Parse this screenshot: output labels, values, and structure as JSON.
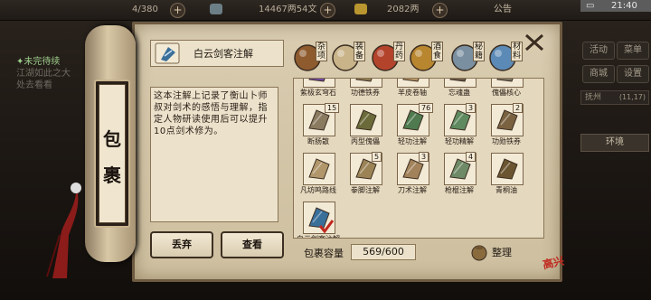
{
  "topbar": {
    "stamina": "4/380",
    "silver": "14467两54文",
    "gold": "2082两",
    "announce": "公告",
    "time": "21:40"
  },
  "quest": {
    "title": "✦未完待续",
    "line1": "江湖如此之大",
    "line2": "处去看看"
  },
  "side": {
    "btn1": "活动",
    "btn2": "菜单",
    "btn3": "商城",
    "btn4": "设置",
    "location": "抚州",
    "loc_extra": "(11,17)",
    "env": "环境"
  },
  "bag": {
    "roll_char_1": "包",
    "roll_char_2": "裹",
    "item_title": "白云剑客注解",
    "description": "这本注解上记录了衡山卜师叔对剑术的感悟与理解，指定人物研读使用后可以提升10点剑术修为。",
    "discard": "丢弃",
    "view": "查看",
    "capacity_label": "包裹容量",
    "capacity_value": "569/600",
    "sort": "整理",
    "stamp": "高兴",
    "tabs": [
      {
        "label": "杂项",
        "icon": "misc-icon"
      },
      {
        "label": "装备",
        "icon": "equipment-icon"
      },
      {
        "label": "丹药",
        "icon": "pill-icon"
      },
      {
        "label": "酒食",
        "icon": "food-icon"
      },
      {
        "label": "秘籍",
        "icon": "manual-icon"
      },
      {
        "label": "材料",
        "icon": "material-icon"
      }
    ],
    "items": [
      {
        "label": "紫极玄穹石",
        "count": "",
        "color": "#6f4aa0"
      },
      {
        "label": "功德铁券",
        "count": "",
        "color": "#8e7b52"
      },
      {
        "label": "羊皮卷轴",
        "count": "",
        "color": "#b89566"
      },
      {
        "label": "忘魂蛊",
        "count": "",
        "color": "#6b5a48"
      },
      {
        "label": "傀儡核心",
        "count": "",
        "color": "#7d7564"
      },
      {
        "label": "断肠散",
        "count": "15",
        "color": "#8a7a60"
      },
      {
        "label": "丙型傀儡",
        "count": "",
        "color": "#6a6a3a"
      },
      {
        "label": "轻功注解",
        "count": "76",
        "color": "#4f7a4f"
      },
      {
        "label": "轻功精解",
        "count": "3",
        "color": "#5f8a5f"
      },
      {
        "label": "功勋铁券",
        "count": "2",
        "color": "#7a6241"
      },
      {
        "label": "凡坊鸣路线",
        "count": "",
        "color": "#b0966a"
      },
      {
        "label": "拳脚注解",
        "count": "5",
        "color": "#9b8356"
      },
      {
        "label": "刀术注解",
        "count": "3",
        "color": "#a2825a"
      },
      {
        "label": "枪棍注解",
        "count": "4",
        "color": "#6e8a66"
      },
      {
        "label": "青桐油",
        "count": "",
        "color": "#6b5530"
      },
      {
        "label": "白云剑客注解",
        "count": "",
        "color": "#3a6f9a",
        "selected": true
      }
    ]
  }
}
